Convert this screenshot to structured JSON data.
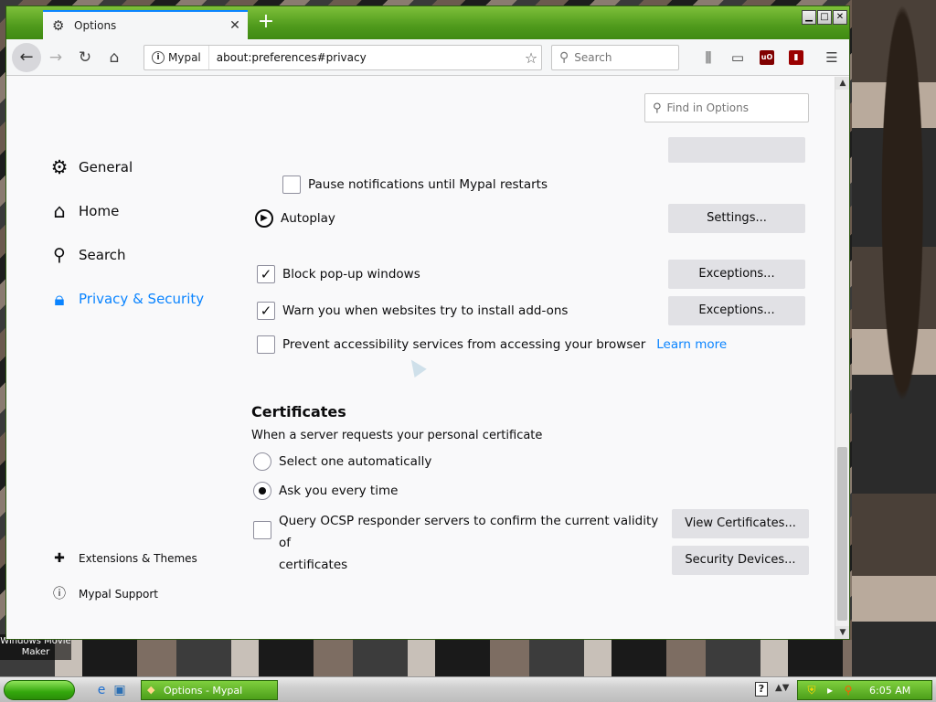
{
  "desktop": {
    "wmm_label": "Windows Movie Maker"
  },
  "window": {
    "tab_title": "Options",
    "new_tab_symbol": "+",
    "controls": {
      "minimize": "▁",
      "maximize": "□",
      "close": "✕"
    }
  },
  "navbar": {
    "identity_label": "Mypal",
    "url": "about:preferences#privacy",
    "search_placeholder": "Search"
  },
  "content": {
    "find_placeholder": "Find in Options",
    "categories": [
      {
        "label": "General",
        "icon": "gear-icon"
      },
      {
        "label": "Home",
        "icon": "home-icon"
      },
      {
        "label": "Search",
        "icon": "search-icon"
      },
      {
        "label": "Privacy & Security",
        "icon": "lock-icon"
      }
    ],
    "footer_links": [
      {
        "label": "Extensions & Themes",
        "icon": "puzzle-icon"
      },
      {
        "label": "Mypal Support",
        "icon": "help-circle-icon"
      }
    ],
    "permissions": {
      "pause_notifications": {
        "label": "Pause notifications until Mypal restarts",
        "checked": false
      },
      "autoplay": {
        "label": "Autoplay",
        "button": "Settings..."
      },
      "block_popups": {
        "label": "Block pop-up windows",
        "checked": true,
        "button": "Exceptions..."
      },
      "warn_addons": {
        "label": "Warn you when websites try to install add-ons",
        "checked": true,
        "button": "Exceptions..."
      },
      "prevent_accessibility": {
        "label": "Prevent accessibility services from accessing your browser",
        "checked": false,
        "link": "Learn more"
      }
    },
    "certificates": {
      "heading": "Certificates",
      "subtext": "When a server requests your personal certificate",
      "options": [
        {
          "label": "Select one automatically",
          "selected": false
        },
        {
          "label": "Ask you every time",
          "selected": true
        }
      ],
      "ocsp_label_line1": "Query OCSP responder servers to confirm the current validity of",
      "ocsp_label_line2": "certificates",
      "ocsp_checked": false,
      "view_certificates": "View Certificates...",
      "security_devices": "Security Devices..."
    }
  },
  "taskbar": {
    "task_label": "Options - Mypal",
    "clock": "6:05 AM"
  }
}
